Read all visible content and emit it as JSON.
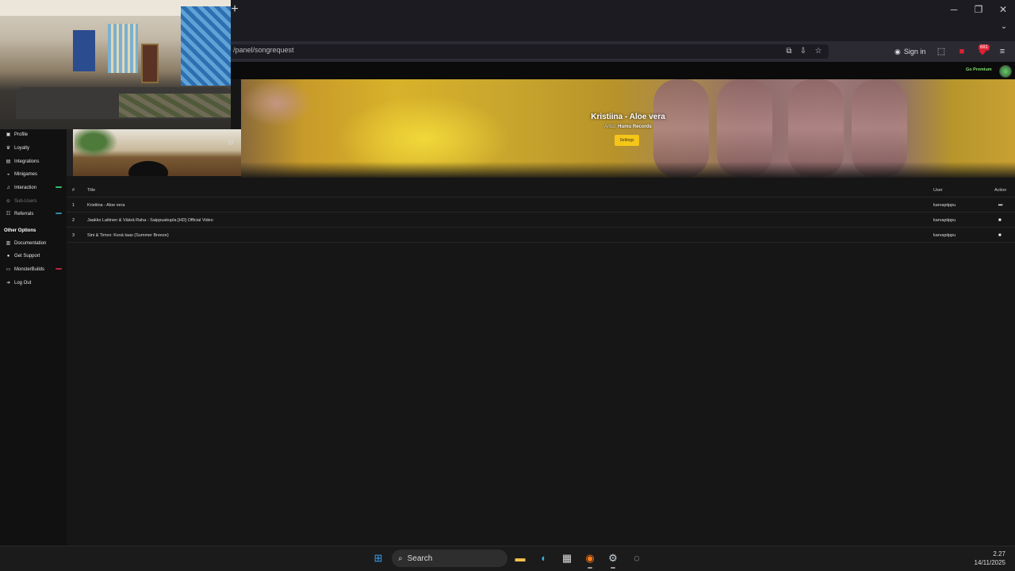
{
  "browser": {
    "url": "/panel/songrequest",
    "new_tab_label": "+",
    "sign_in_label": "Sign in",
    "extension_badge": "681",
    "window_controls": [
      "minimize",
      "restore",
      "close"
    ]
  },
  "site": {
    "go_premium": "Go Premium"
  },
  "sidebar": {
    "items": [
      {
        "label": "Profile",
        "icon": "profile-icon"
      },
      {
        "label": "Loyalty",
        "icon": "trophy-icon"
      },
      {
        "label": "Integrations",
        "icon": "integrations-icon"
      },
      {
        "label": "Minigames",
        "icon": "gamepad-icon"
      },
      {
        "label": "Interaction",
        "icon": "music-icon"
      },
      {
        "label": "Sub-Users",
        "icon": "users-icon"
      },
      {
        "label": "Referrals",
        "icon": "referrals-icon"
      }
    ],
    "other_options_heading": "Other Options",
    "other_items": [
      {
        "label": "Documentation",
        "icon": "book-icon"
      },
      {
        "label": "Get Support",
        "icon": "support-icon"
      },
      {
        "label": "MonsterBuilds",
        "icon": "monitor-icon"
      },
      {
        "label": "Log Out",
        "icon": "logout-icon"
      }
    ]
  },
  "now_playing": {
    "title": "Kristiina - Aloe vera",
    "artist_label": "Artist:",
    "artist": "Humu Records",
    "settings_label": "Settings"
  },
  "queue": {
    "headers": {
      "num": "#",
      "title": "Title",
      "user": "User",
      "action": "Action"
    },
    "rows": [
      {
        "num": "1",
        "title": "Kristiina - Aloe vera",
        "user": "karvapiippu",
        "action": "play"
      },
      {
        "num": "2",
        "title": "Jaakko Laitinen & Väärä Raha - Saippuakupla [HD] Official Video",
        "user": "karvapiippu",
        "action": "delete"
      },
      {
        "num": "3",
        "title": "Sini & Timxx: Kesä taas (Summer Breeze)",
        "user": "karvapiippu",
        "action": "delete"
      }
    ]
  },
  "taskbar": {
    "search_label": "Search",
    "time": "2.27",
    "date": "14/11/2025",
    "colors": {
      "windows_blue": "#3aa0f3",
      "accent_yellow": "#f5c518"
    }
  }
}
